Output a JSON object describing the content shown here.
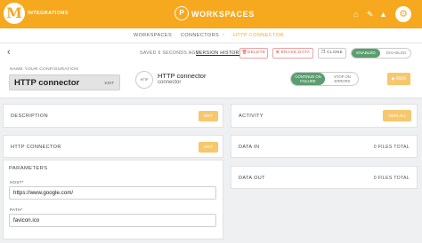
{
  "header": {
    "logo_letter": "M",
    "app_name": "INTEGRATIONS",
    "workspace_icon_letter": "P",
    "workspace_label": "WORKSPACES",
    "icons": [
      "home-icon",
      "wrench-icon",
      "bell-icon",
      "settings-icon"
    ]
  },
  "breadcrumb": {
    "items": [
      "WORKSPACES",
      "/",
      "CONNECTORS",
      "/",
      "HTTP CONNECTOR"
    ]
  },
  "toolbar": {
    "back": "‹",
    "saved_text": "SAVED 6 SECONDS AGO",
    "version_history": "VERSION HISTORY",
    "delete_label": "DELETE",
    "erase_label": "ERASE DATA",
    "clone_label": "CLONE",
    "enabled_label": "ENABLED",
    "disabled_label": "DISABLED"
  },
  "config": {
    "name_label": "NAME YOUR CONFIGURATION",
    "name_value": "HTTP connector",
    "edit_label": "EDIT",
    "connector_logo_text": "HTTP",
    "connector_title": "HTTP connector",
    "connector_subtitle": "connector",
    "continue_on_failure": "CONTINUE ON FAILURE",
    "stop_on_errors": "STOP ON ERRORS",
    "run_label": "RUN"
  },
  "panels": {
    "description": {
      "title": "DESCRIPTION",
      "button": "EDIT"
    },
    "activity": {
      "title": "ACTIVITY",
      "button": "VIEW ALL"
    },
    "http_connector": {
      "title": "HTTP CONNECTOR",
      "button": "EDIT"
    },
    "data_in": {
      "title": "DATA IN",
      "value": "0 FILES TOTAL"
    },
    "data_out": {
      "title": "DATA OUT",
      "value": "0 FILES TOTAL"
    }
  },
  "parameters": {
    "label": "PARAMETERS",
    "host_label": "HOST*",
    "host_value": "https://www.google.com/",
    "path_label": "PATH*",
    "path_value": "favicon.ico"
  },
  "colors": {
    "brand": "#f6a81f",
    "enabled_green": "#5a9e6f",
    "danger": "#d9534f",
    "button_orange": "#f6c76b"
  }
}
